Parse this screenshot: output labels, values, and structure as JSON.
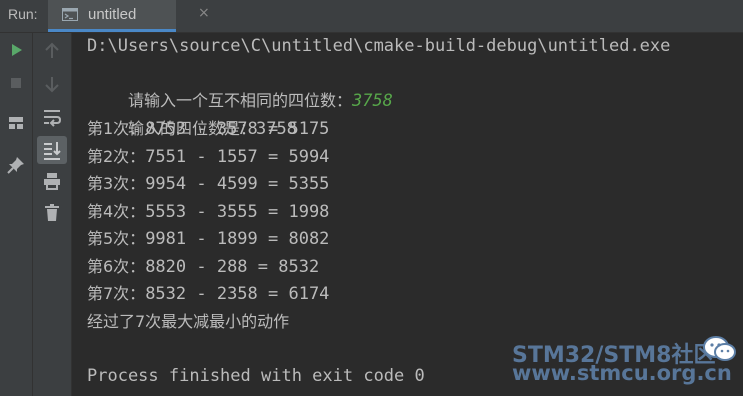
{
  "header": {
    "run_label": "Run:",
    "tab_label": "untitled",
    "tab_close": "×",
    "tab_icon": "console-window-icon",
    "accent": "#4a88c7"
  },
  "toolbar_left": [
    {
      "icon": "play-icon",
      "color": "#59a869"
    },
    {
      "icon": "stop-icon",
      "color": "#5a5d5f"
    },
    {
      "icon": "layout-icon",
      "color": "#afb1b3"
    },
    {
      "icon": "pin-icon",
      "color": "#afb1b3"
    }
  ],
  "toolbar_right": [
    {
      "icon": "arrow-up-icon"
    },
    {
      "icon": "arrow-down-icon"
    },
    {
      "icon": "soft-wrap-icon"
    },
    {
      "icon": "scroll-to-end-icon",
      "selected": true
    },
    {
      "icon": "print-icon"
    },
    {
      "icon": "trash-icon"
    }
  ],
  "console": {
    "path": "D:\\Users\\source\\C\\untitled\\cmake-build-debug\\untitled.exe",
    "prompt": "请输入一个互不相同的四位数：",
    "user_input": "3758",
    "input_echo_label": "输入的四位数是：",
    "input_echo_value": "3758",
    "steps": [
      {
        "label": "第1次：",
        "expr": "8753 - 3578 = 5175"
      },
      {
        "label": "第2次：",
        "expr": "7551 - 1557 = 5994"
      },
      {
        "label": "第3次：",
        "expr": "9954 - 4599 = 5355"
      },
      {
        "label": "第4次：",
        "expr": "5553 - 3555 = 1998"
      },
      {
        "label": "第5次：",
        "expr": "9981 - 1899 = 8082"
      },
      {
        "label": "第6次：",
        "expr": "8820 - 288 = 8532"
      },
      {
        "label": "第7次：",
        "expr": "8532 - 2358 = 6174"
      }
    ],
    "summary": "经过了7次最大减最小的动作",
    "finished": "Process finished with exit code 0",
    "text_color": "#bbbbbb",
    "input_color": "#57a64a"
  },
  "watermark": {
    "line1": "STM32/STM8社区",
    "line2": "www.stmcu.org.cn"
  }
}
